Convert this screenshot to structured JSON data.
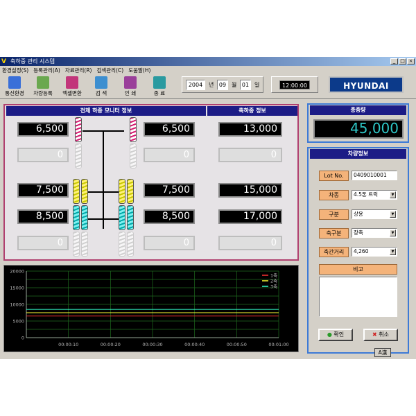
{
  "window": {
    "title": "축하중 관리 시스템",
    "app_logo_letter": "V"
  },
  "menu": [
    "환경설정(S)",
    "등록관리(A)",
    "자료관리(R)",
    "검색관리(C)",
    "도움말(H)"
  ],
  "toolbar": [
    {
      "label": "통신환경",
      "icon": "network-icon",
      "color": "#3a6fd8"
    },
    {
      "label": "차량등록",
      "icon": "truck-icon",
      "color": "#6aa84f"
    },
    {
      "label": "엑셀변환",
      "icon": "excel-icon",
      "color": "#c2357a"
    },
    {
      "label": "검  색",
      "icon": "magnifier-icon",
      "color": "#3d8fd0"
    },
    {
      "label": "인  쇄",
      "icon": "printer-icon",
      "color": "#9a3f9a"
    },
    {
      "label": "종  료",
      "icon": "exit-icon",
      "color": "#2a9aa0"
    }
  ],
  "date": {
    "year": "2004",
    "year_unit": "년",
    "month": "09",
    "month_unit": "월",
    "day": "01",
    "day_unit": "일"
  },
  "clock": "12:00:00",
  "brand": "HYUNDAI",
  "monitor": {
    "title": "전체 하중 모니터 정보",
    "left_values": [
      "6,500",
      "0",
      "7,500",
      "8,500",
      "0"
    ],
    "right_values": [
      "6,500",
      "0",
      "7,500",
      "8,500",
      "0"
    ]
  },
  "axle_info": {
    "title": "축하중 정보",
    "values": [
      "13,000",
      "0",
      "15,000",
      "17,000",
      "0"
    ]
  },
  "total": {
    "title": "총중량",
    "value": "45,000"
  },
  "vehicle": {
    "title": "차량정보",
    "lot_label": "Lot No.",
    "lot_value": "0409010001",
    "type_label": "차종",
    "type_value": "4.5톤 트럭",
    "class_label": "구분",
    "class_value": "상용",
    "axle_class_label": "축구분",
    "axle_class_value": "장축",
    "axle_dist_label": "축간거리",
    "axle_dist_value": "4,260",
    "note_label": "비고",
    "ok_label": "확인",
    "cancel_label": "취소"
  },
  "ime": "A漢",
  "colors": {
    "axis1": "#ff3333",
    "axis2": "#ffff33",
    "axis3": "#33ffcc",
    "panel_border": "#b0406f",
    "header": "#1c1c86"
  },
  "chart_data": {
    "type": "line",
    "x": [
      "00:00:00",
      "00:00:10",
      "00:00:20",
      "00:00:30",
      "00:00:40",
      "00:00:50",
      "00:01:00"
    ],
    "ylim": [
      0,
      20000
    ],
    "yticks": [
      "20000",
      "15000",
      "10000",
      "5000",
      "0"
    ],
    "xticks": [
      "00:00:10",
      "00:00:20",
      "00:00:30",
      "00:00:40",
      "00:00:50",
      "00:01:00"
    ],
    "series": [
      {
        "name": "1축",
        "values": [
          6500,
          6500,
          6500,
          6500,
          6500,
          6500,
          6500
        ],
        "color": "#ff3333"
      },
      {
        "name": "2축",
        "values": [
          7500,
          7500,
          7500,
          7500,
          7500,
          7500,
          7500
        ],
        "color": "#ffff33"
      },
      {
        "name": "3축",
        "values": [
          8500,
          8500,
          8500,
          8500,
          8500,
          8500,
          8500
        ],
        "color": "#33ffcc"
      }
    ]
  }
}
